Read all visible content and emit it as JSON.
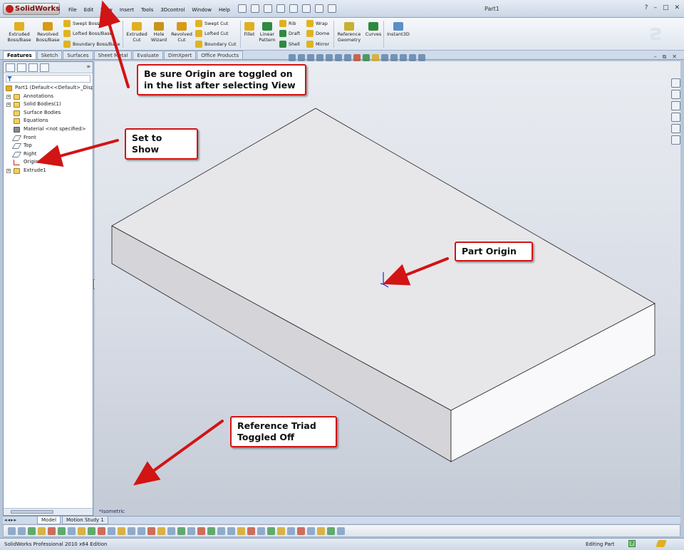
{
  "app": {
    "logo": "SolidWorks",
    "title": "Part1",
    "menu": [
      "File",
      "Edit",
      "View",
      "Insert",
      "Tools",
      "3Dcontrol",
      "Window",
      "Help"
    ],
    "window_controls": [
      "?",
      "–",
      "□",
      "✕"
    ]
  },
  "ribbon": {
    "extruded_boss": "Extruded\nBoss/Base",
    "revolved_boss": "Revolved\nBoss/Base",
    "swept_boss": "Swept Boss/Base",
    "lofted_boss": "Lofted Boss/Base",
    "boundary_boss": "Boundary Boss/Base",
    "extruded_cut": "Extruded\nCut",
    "hole_wizard": "Hole\nWizard",
    "revolved_cut": "Revolved\nCut",
    "swept_cut": "Swept Cut",
    "lofted_cut": "Lofted Cut",
    "boundary_cut": "Boundary Cut",
    "fillet": "Fillet",
    "linear_pattern": "Linear\nPattern",
    "rib": "Rib",
    "draft": "Draft",
    "shell": "Shell",
    "wrap": "Wrap",
    "dome": "Dome",
    "mirror": "Mirror",
    "reference_geometry": "Reference\nGeometry",
    "curves": "Curves",
    "instant3d": "Instant3D"
  },
  "tabs": [
    "Features",
    "Sketch",
    "Surfaces",
    "Sheet Metal",
    "Evaluate",
    "DimXpert",
    "Office Products"
  ],
  "tree": {
    "root": "Part1  (Default<<Default>_Displa",
    "items": [
      {
        "label": "Annotations",
        "icon": "annotations-icon",
        "expandable": true
      },
      {
        "label": "Solid Bodies(1)",
        "icon": "solid-bodies-icon",
        "expandable": true
      },
      {
        "label": "Surface Bodies",
        "icon": "surface-bodies-icon",
        "expandable": false
      },
      {
        "label": "Equations",
        "icon": "equations-icon",
        "expandable": false
      },
      {
        "label": "Material <not specified>",
        "icon": "material-icon",
        "expandable": false
      },
      {
        "label": "Front",
        "icon": "plane-icon",
        "expandable": false
      },
      {
        "label": "Top",
        "icon": "plane-icon",
        "expandable": false
      },
      {
        "label": "Right",
        "icon": "plane-icon",
        "expandable": false
      },
      {
        "label": "Origin",
        "icon": "origin-icon",
        "expandable": false
      },
      {
        "label": "Extrude1",
        "icon": "extrude-icon",
        "expandable": true
      }
    ]
  },
  "viewport": {
    "view_name": "*Isometric"
  },
  "callouts": {
    "origin_toggle": "Be sure Origin are toggled on in the list after selecting View",
    "set_to_show": "Set to Show",
    "part_origin": "Part Origin",
    "reference_triad": "Reference Triad Toggled Off"
  },
  "bottom_tabs": [
    "Model",
    "Motion Study 1"
  ],
  "status": {
    "left": "SolidWorks Professional 2010 x64 Edition",
    "right": "Editing Part"
  },
  "colors": {
    "callout_border": "#d21414",
    "arrow": "#d21414",
    "origin": "#1a2ad0"
  }
}
